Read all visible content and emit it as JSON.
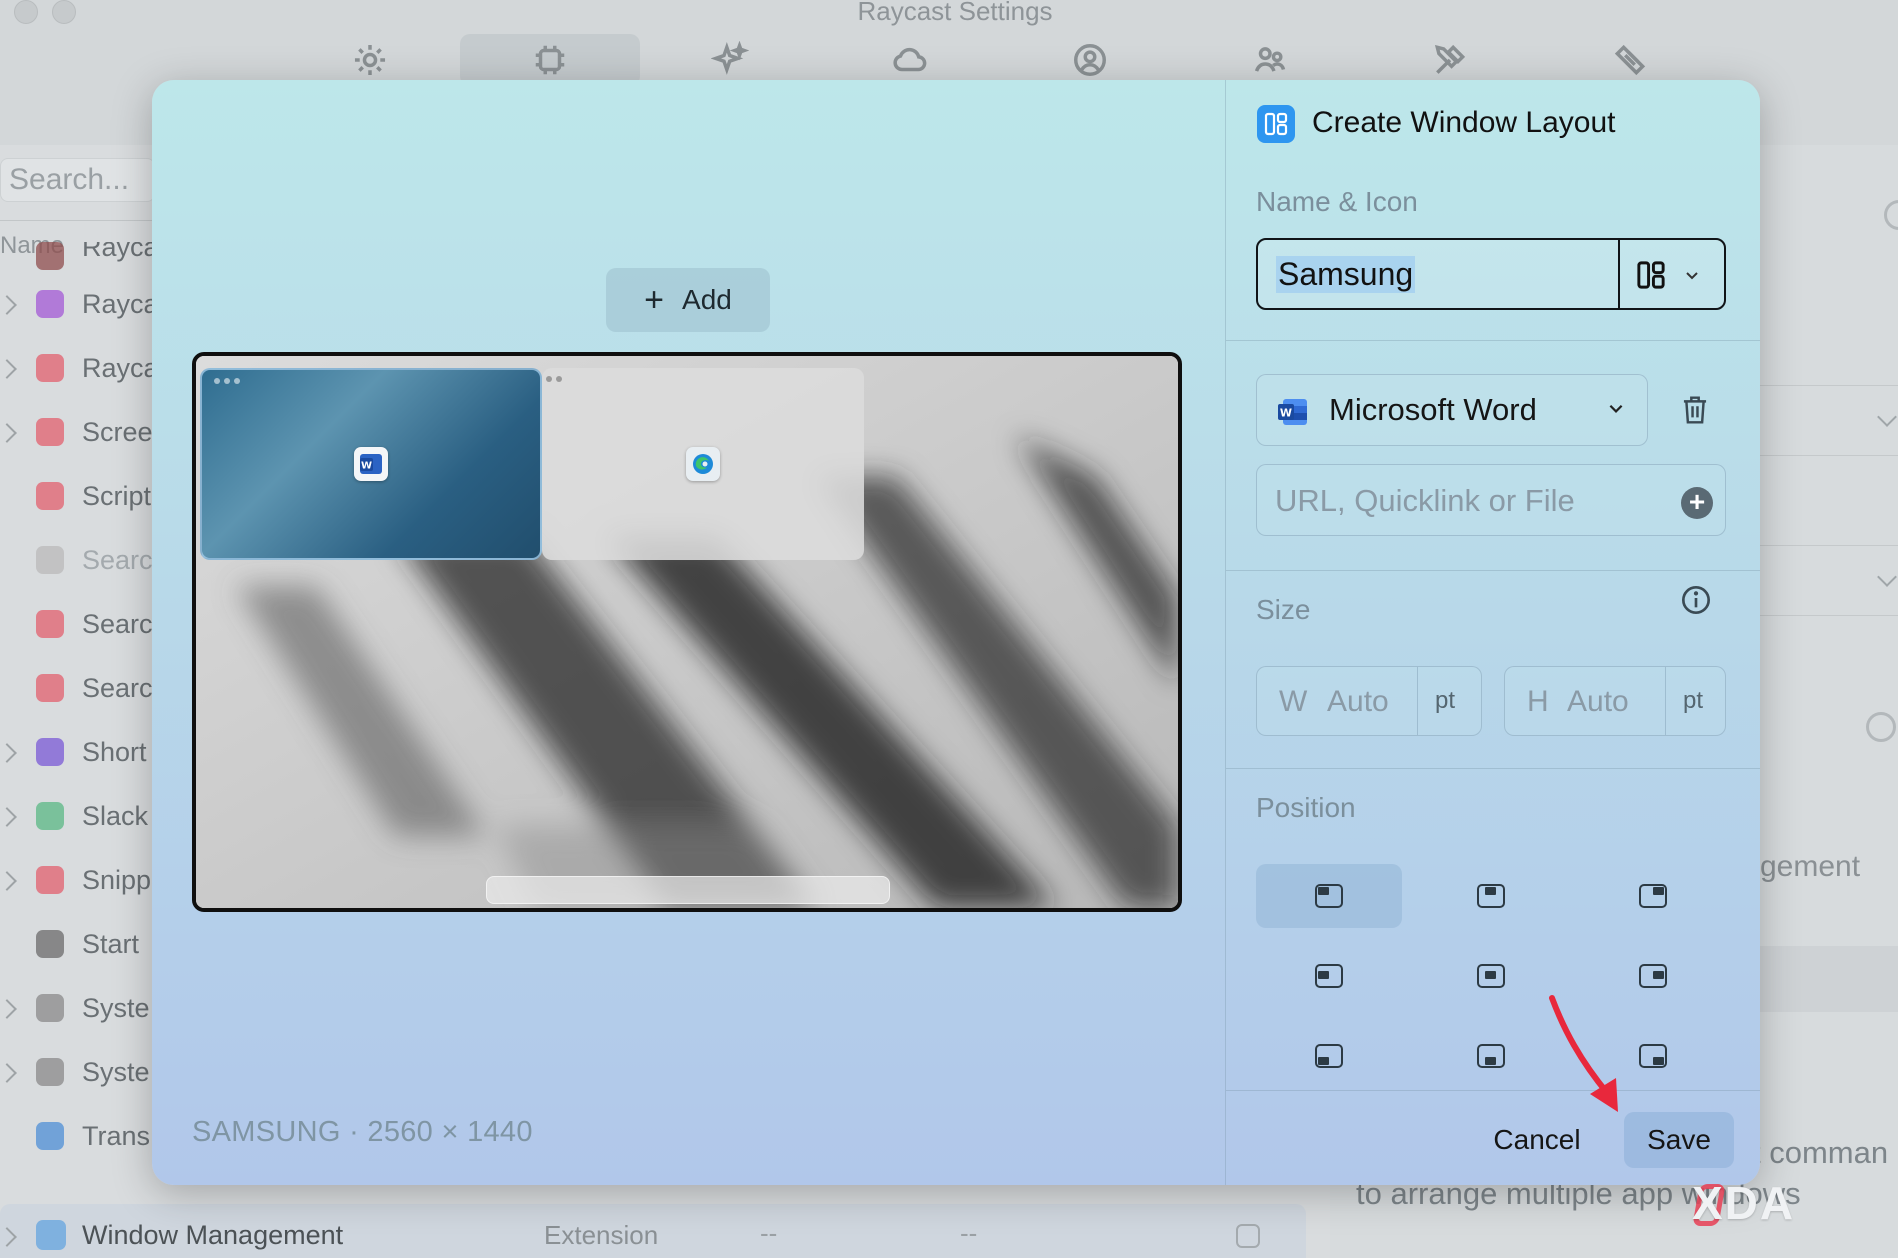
{
  "window": {
    "title": "Raycast Settings"
  },
  "toolbar": {
    "tabs": [
      {
        "icon": "gear-icon"
      },
      {
        "icon": "extensions-icon",
        "active": true
      },
      {
        "icon": "sparkle-icon"
      },
      {
        "icon": "cloud-icon"
      },
      {
        "icon": "account-icon"
      },
      {
        "icon": "organizations-icon"
      },
      {
        "icon": "tools-icon"
      },
      {
        "icon": "advanced-icon"
      }
    ]
  },
  "sidebar": {
    "search_placeholder": "Search...",
    "column_name": "Name",
    "items": [
      {
        "label": "Rayca",
        "color": "#8f4d4d"
      },
      {
        "label": "Rayca",
        "color": "#a35ad6"
      },
      {
        "label": "Rayca",
        "color": "#e2606e"
      },
      {
        "label": "Scree",
        "color": "#e2606e"
      },
      {
        "label": "Script",
        "color": "#e2606e"
      },
      {
        "label": "Searc",
        "color": "#b9b9b9"
      },
      {
        "label": "Searc",
        "color": "#e2606e"
      },
      {
        "label": "Searc",
        "color": "#e2606e"
      },
      {
        "label": "Short",
        "color": "#7a5ad6"
      },
      {
        "label": "Slack",
        "color": "#5ab884"
      },
      {
        "label": "Snipp",
        "color": "#e2606e"
      },
      {
        "label": "Start ",
        "color": "#6b6b6b"
      },
      {
        "label": "Syste",
        "color": "#8a8a8a"
      },
      {
        "label": "Syste",
        "color": "#8a8a8a"
      },
      {
        "label": "Trans",
        "color": "#4d8fd6"
      }
    ],
    "selected_row": {
      "label": "Window Management",
      "type": "Extension",
      "alias": "--",
      "hotkey": "--"
    }
  },
  "background_right": {
    "text_agement": "gement",
    "text_command": "t comman",
    "text_arrange": "to arrange multiple app windows"
  },
  "modal": {
    "add_label": "Add",
    "display_label": "SAMSUNG · 2560 × 1440",
    "title": "Create Window Layout",
    "name_icon_label": "Name & Icon",
    "name_value": "Samsung",
    "app_name": "Microsoft Word",
    "url_placeholder": "URL, Quicklink or File",
    "size_label": "Size",
    "width": {
      "prefix": "W",
      "value": "Auto",
      "unit": "pt"
    },
    "height": {
      "prefix": "H",
      "value": "Auto",
      "unit": "pt"
    },
    "position_label": "Position",
    "positions": [
      "top-left",
      "top-center",
      "top-right",
      "middle-left",
      "center",
      "middle-right",
      "bottom-left",
      "bottom-center",
      "bottom-right"
    ],
    "selected_position": "top-left",
    "cancel_label": "Cancel",
    "save_label": "Save"
  },
  "watermark": "XDA",
  "colors": {
    "accent": "#2e96f0",
    "arrow": "#e8283c"
  }
}
